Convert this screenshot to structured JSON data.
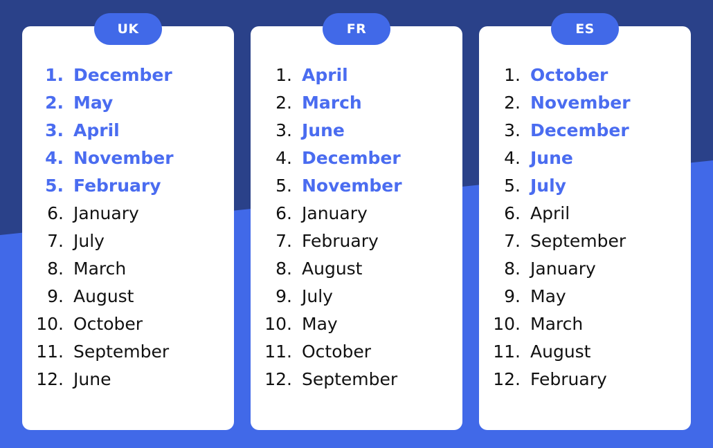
{
  "theme": {
    "background_top": "#2a4189",
    "background_bottom": "#4169e8",
    "card_background": "#ffffff",
    "badge_background": "#4169e8",
    "badge_text": "#ffffff",
    "highlight_text": "#4a6cf0",
    "normal_text": "#111111"
  },
  "columns": [
    {
      "badge": "UK",
      "highlight_count": 5,
      "highlight_numbers": true,
      "items": [
        {
          "rank": "1.",
          "label": "December"
        },
        {
          "rank": "2.",
          "label": "May"
        },
        {
          "rank": "3.",
          "label": "April"
        },
        {
          "rank": "4.",
          "label": "November"
        },
        {
          "rank": "5.",
          "label": "February"
        },
        {
          "rank": "6.",
          "label": "January"
        },
        {
          "rank": "7.",
          "label": "July"
        },
        {
          "rank": "8.",
          "label": "March"
        },
        {
          "rank": "9.",
          "label": "August"
        },
        {
          "rank": "10.",
          "label": "October"
        },
        {
          "rank": "11.",
          "label": "September"
        },
        {
          "rank": "12.",
          "label": "June"
        }
      ]
    },
    {
      "badge": "FR",
      "highlight_count": 5,
      "highlight_numbers": false,
      "items": [
        {
          "rank": "1.",
          "label": "April"
        },
        {
          "rank": "2.",
          "label": "March"
        },
        {
          "rank": "3.",
          "label": "June"
        },
        {
          "rank": "4.",
          "label": "December"
        },
        {
          "rank": "5.",
          "label": "November"
        },
        {
          "rank": "6.",
          "label": "January"
        },
        {
          "rank": "7.",
          "label": "February"
        },
        {
          "rank": "8.",
          "label": "August"
        },
        {
          "rank": "9.",
          "label": "July"
        },
        {
          "rank": "10.",
          "label": "May"
        },
        {
          "rank": "11.",
          "label": "October"
        },
        {
          "rank": "12.",
          "label": "September"
        }
      ]
    },
    {
      "badge": "ES",
      "highlight_count": 5,
      "highlight_numbers": false,
      "items": [
        {
          "rank": "1.",
          "label": "October"
        },
        {
          "rank": "2.",
          "label": "November"
        },
        {
          "rank": "3.",
          "label": "December"
        },
        {
          "rank": "4.",
          "label": "June"
        },
        {
          "rank": "5.",
          "label": "July"
        },
        {
          "rank": "6.",
          "label": "April"
        },
        {
          "rank": "7.",
          "label": "September"
        },
        {
          "rank": "8.",
          "label": "January"
        },
        {
          "rank": "9.",
          "label": "May"
        },
        {
          "rank": "10.",
          "label": "March"
        },
        {
          "rank": "11.",
          "label": "August"
        },
        {
          "rank": "12.",
          "label": "February"
        }
      ]
    }
  ]
}
